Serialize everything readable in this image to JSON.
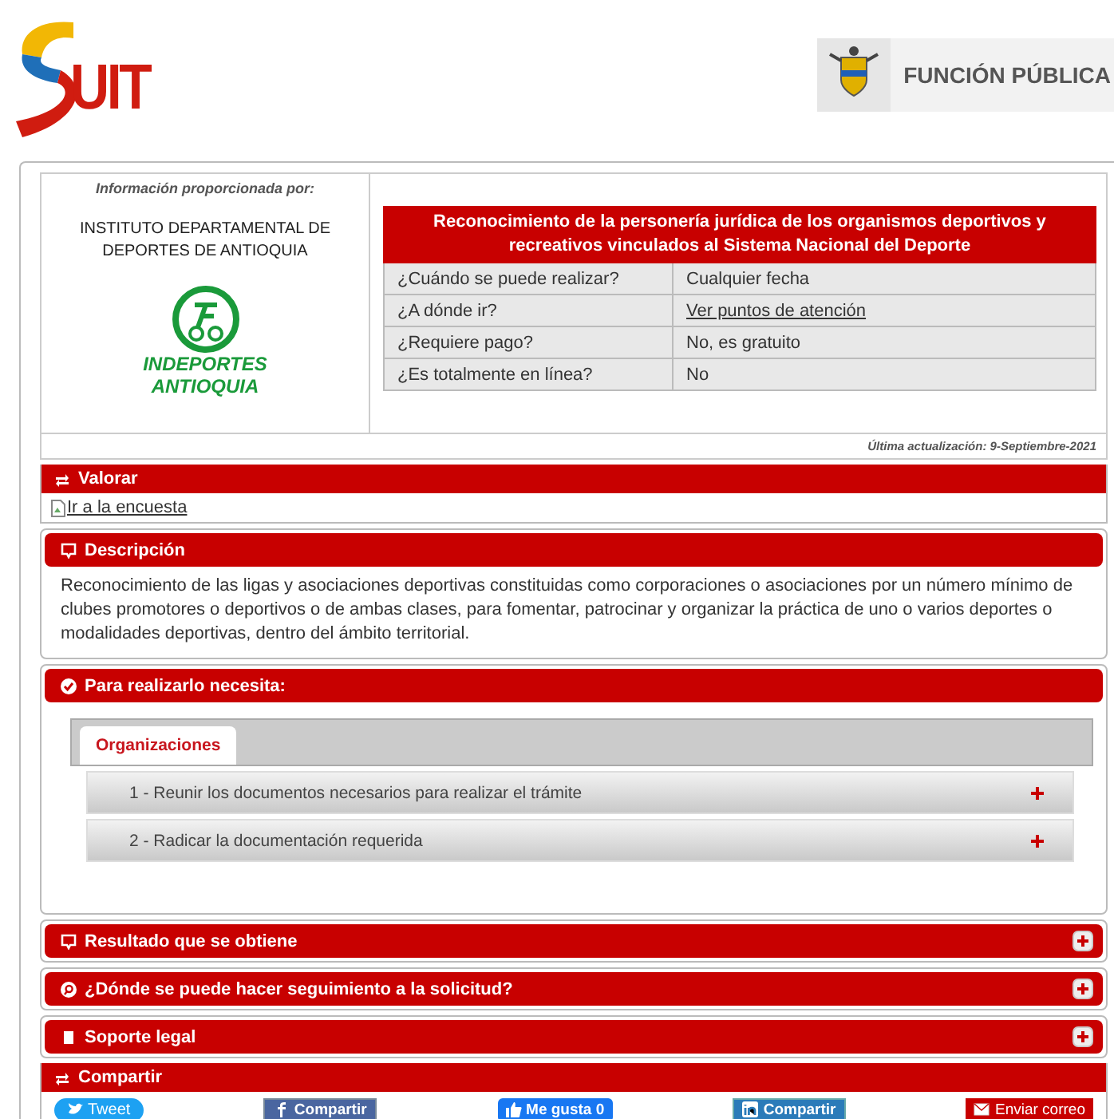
{
  "header": {
    "logo_text": "UIT",
    "agency": "FUNCIÓN PÚBLICA"
  },
  "provider": {
    "caption": "Información proporcionada por:",
    "name": "INSTITUTO DEPARTAMENTAL DE DEPORTES DE ANTIOQUIA",
    "logo_lines": [
      "INDEPORTES",
      "ANTIOQUIA"
    ]
  },
  "summary": {
    "title": "Reconocimiento de la personería jurídica de los organismos deportivos y recreativos vinculados al Sistema Nacional del Deporte",
    "rows": [
      {
        "label": "¿Cuándo se puede realizar?",
        "value": "Cualquier fecha",
        "kind": "text"
      },
      {
        "label": "¿A dónde ir?",
        "value": "Ver puntos de atención",
        "kind": "link"
      },
      {
        "label": "¿Requiere pago?",
        "value": "No, es gratuito",
        "kind": "text"
      },
      {
        "label": "¿Es totalmente en línea?",
        "value": "No",
        "kind": "text"
      }
    ]
  },
  "updated": "Última actualización: 9-Septiembre-2021",
  "sections": [
    {
      "title": "Valorar",
      "kind": "flat",
      "expanded": true,
      "body": {
        "kind": "link",
        "text": "Ir a la encuesta"
      }
    },
    {
      "title": "Descripción",
      "kind": "card",
      "expanded": true,
      "body": {
        "kind": "text",
        "text": "Reconocimiento de las ligas y asociaciones deportivas constituidas como corporaciones o asociaciones por un número mínimo de clubes promotores o deportivos o de ambas clases, para fomentar, patrocinar y organizar la práctica de uno o varios deportes o modalidades deportivas, dentro del ámbito territorial."
      }
    },
    {
      "title": "Para realizarlo necesita:",
      "kind": "card",
      "expanded": true,
      "body": {
        "kind": "steps",
        "tabs": [
          {
            "label": "Organizaciones",
            "selected": true
          }
        ],
        "steps": [
          {
            "label": "1 - Reunir los documentos necesarios para realizar el trámite",
            "expanded": false
          },
          {
            "label": "2 - Radicar la documentación requerida",
            "expanded": false
          }
        ]
      }
    },
    {
      "title": "Resultado que se obtiene",
      "kind": "card",
      "expanded": false
    },
    {
      "title": "¿Dónde se puede hacer seguimiento a la solicitud?",
      "kind": "card",
      "expanded": false
    },
    {
      "title": "Soporte legal",
      "kind": "card",
      "expanded": false
    },
    {
      "title": "Compartir",
      "kind": "flat",
      "expanded": true,
      "body": {
        "kind": "share",
        "buttons": [
          {
            "label": "Tweet",
            "kind": "twitter"
          },
          {
            "label": "Compartir",
            "kind": "facebook"
          },
          {
            "label": "Me gusta 0",
            "kind": "like"
          },
          {
            "label": "Compartir",
            "kind": "linkedin"
          },
          {
            "label": "Enviar correo",
            "kind": "email"
          }
        ]
      }
    }
  ]
}
